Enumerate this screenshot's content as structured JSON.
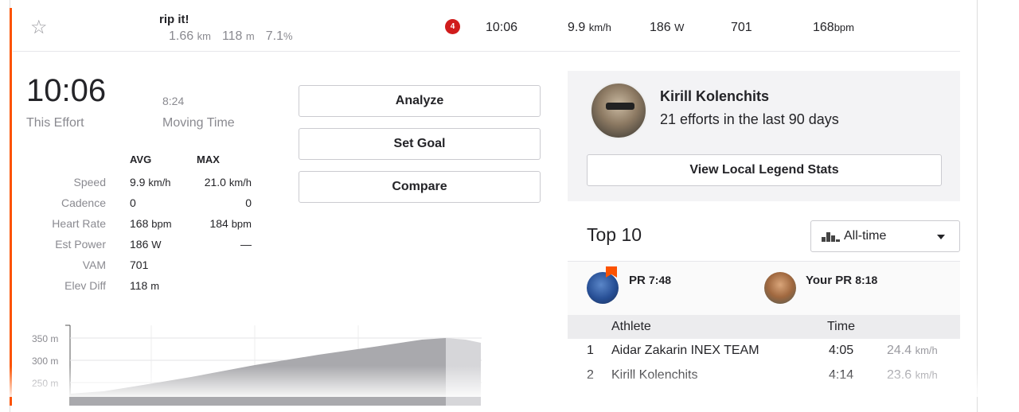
{
  "segment": {
    "name": "rip it!",
    "distance": "1.66",
    "distance_unit": "km",
    "elevation": "118",
    "elevation_unit": "m",
    "grade": "7.1",
    "grade_unit": "%",
    "rank_badge": "4",
    "time": "10:06",
    "speed": "9.9",
    "speed_unit": "km/h",
    "power": "186",
    "power_unit": "W",
    "vam": "701",
    "heart_rate": "168",
    "heart_rate_unit": "bpm"
  },
  "effort": {
    "time": "10:06",
    "time_label": "This Effort",
    "moving_time": "8:24",
    "moving_label": "Moving Time",
    "avg_header": "AVG",
    "max_header": "MAX",
    "rows": [
      {
        "label": "Speed",
        "avg": "9.9",
        "avg_unit": "km/h",
        "max": "21.0",
        "max_unit": "km/h"
      },
      {
        "label": "Cadence",
        "avg": "0",
        "avg_unit": "",
        "max": "0",
        "max_unit": ""
      },
      {
        "label": "Heart Rate",
        "avg": "168",
        "avg_unit": "bpm",
        "max": "184",
        "max_unit": "bpm"
      },
      {
        "label": "Est Power",
        "avg": "186",
        "avg_unit": "W",
        "max": "—",
        "max_unit": ""
      },
      {
        "label": "VAM",
        "avg": "701",
        "avg_unit": "",
        "max": "",
        "max_unit": ""
      },
      {
        "label": "Elev Diff",
        "avg": "118",
        "avg_unit": "m",
        "max": "",
        "max_unit": ""
      }
    ]
  },
  "actions": {
    "analyze": "Analyze",
    "set_goal": "Set Goal",
    "compare": "Compare"
  },
  "local_legend": {
    "name": "Kirill Kolenchits",
    "efforts": "21 efforts in the last 90 days",
    "button": "View Local Legend Stats"
  },
  "top10": {
    "title": "Top 10",
    "filter": "All-time",
    "pr_label": "PR",
    "pr_time": "7:48",
    "your_pr_label": "Your PR",
    "your_pr_time": "8:18",
    "col_athlete": "Athlete",
    "col_time": "Time",
    "rows": [
      {
        "rank": "1",
        "athlete": "Aidar Zakarin INEX TEAM",
        "time": "4:05",
        "speed": "24.4",
        "unit": "km/h"
      },
      {
        "rank": "2",
        "athlete": "Kirill Kolenchits",
        "time": "4:14",
        "speed": "23.6",
        "unit": "km/h"
      }
    ]
  },
  "elevation_chart": {
    "y_ticks": [
      "350 m",
      "300 m",
      "250 m"
    ]
  },
  "colors": {
    "accent": "#fc5200",
    "badge": "#d01c1c"
  }
}
